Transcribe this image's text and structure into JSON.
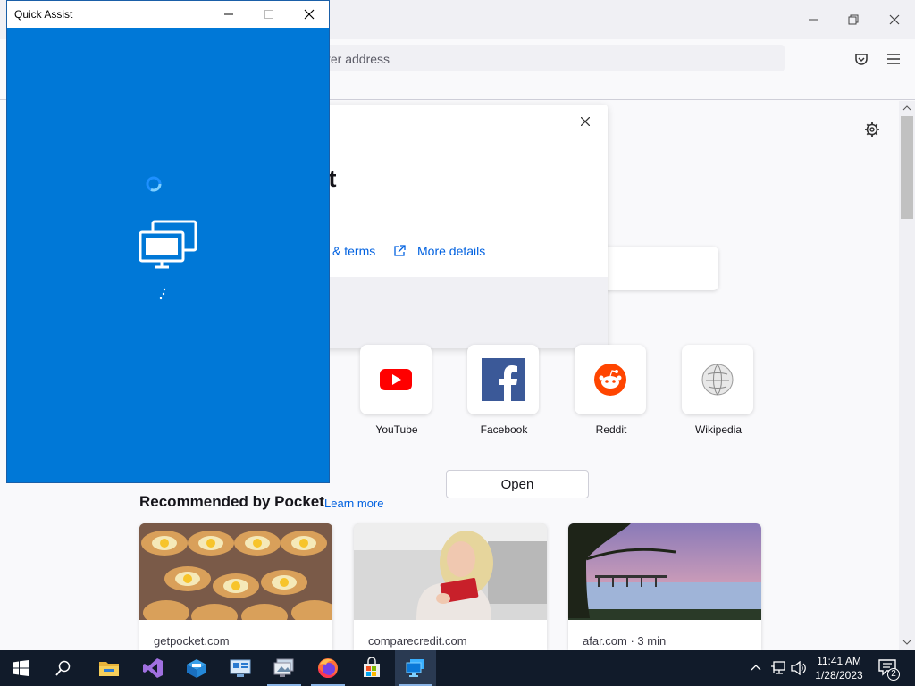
{
  "browser": {
    "url_placeholder": "ter address",
    "dialog": {
      "title_fragment": "ist",
      "terms_link": "& terms",
      "more_details_link": "More details",
      "open_button": "Open"
    },
    "top_sites": [
      {
        "label": "YouTube",
        "icon": "youtube-icon"
      },
      {
        "label": "Facebook",
        "icon": "facebook-icon"
      },
      {
        "label": "Reddit",
        "icon": "reddit-icon"
      },
      {
        "label": "Wikipedia",
        "icon": "wikipedia-icon"
      }
    ],
    "pocket": {
      "title": "Recommended by Pocket",
      "learn_more": "Learn more",
      "cards": [
        {
          "source": "getpocket.com"
        },
        {
          "source": "comparecredit.com"
        },
        {
          "source": "afar.com · 3 min"
        }
      ]
    }
  },
  "quick_assist": {
    "title": "Quick Assist"
  },
  "taskbar": {
    "apps": [
      "start-icon",
      "search-icon",
      "file-explorer-icon",
      "visual-studio-icon",
      "sandbox-icon",
      "network-icon",
      "remote-desktop-icon",
      "firefox-icon",
      "store-icon",
      "quick-assist-icon"
    ],
    "time": "11:41 AM",
    "date": "1/28/2023",
    "notification_count": "2"
  },
  "colors": {
    "quick_assist_bg": "#0078d7",
    "link": "#0061e0",
    "taskbar": "#111b2a"
  }
}
